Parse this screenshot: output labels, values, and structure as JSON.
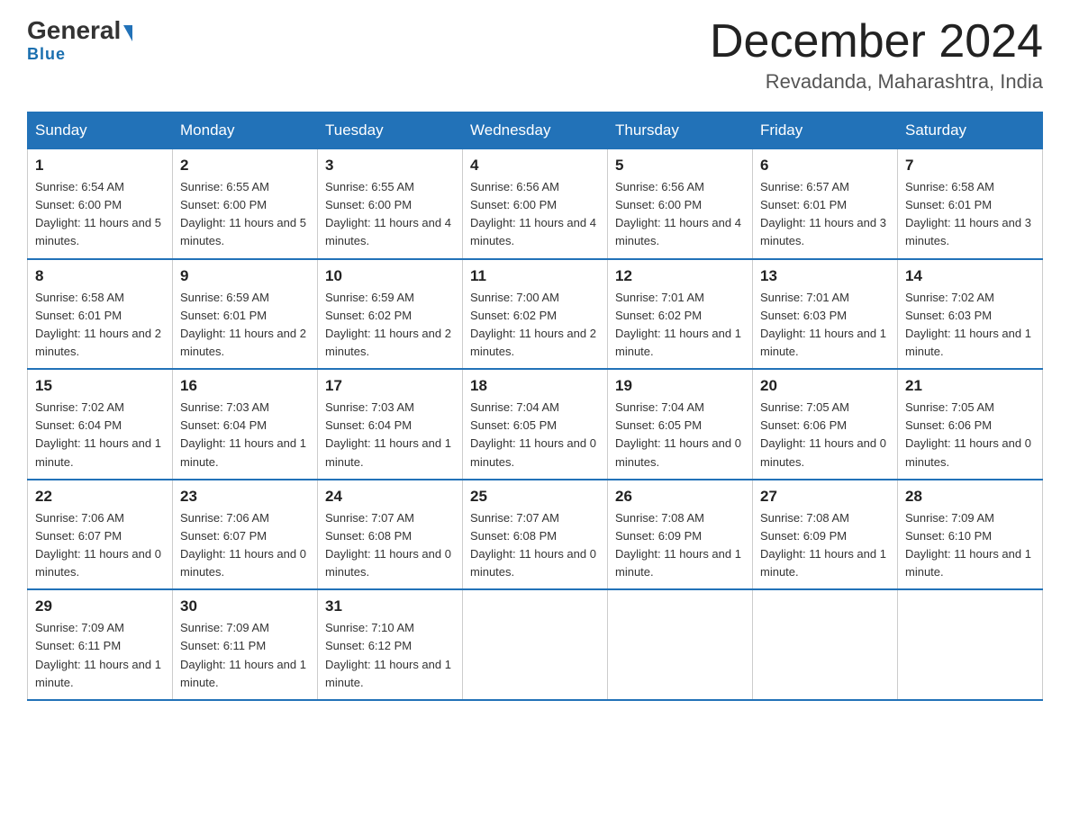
{
  "logo": {
    "general": "General",
    "blue": "Blue",
    "triangle": "▶"
  },
  "title": "December 2024",
  "location": "Revadanda, Maharashtra, India",
  "headers": [
    "Sunday",
    "Monday",
    "Tuesday",
    "Wednesday",
    "Thursday",
    "Friday",
    "Saturday"
  ],
  "weeks": [
    [
      {
        "day": "1",
        "sunrise": "6:54 AM",
        "sunset": "6:00 PM",
        "daylight": "11 hours and 5 minutes."
      },
      {
        "day": "2",
        "sunrise": "6:55 AM",
        "sunset": "6:00 PM",
        "daylight": "11 hours and 5 minutes."
      },
      {
        "day": "3",
        "sunrise": "6:55 AM",
        "sunset": "6:00 PM",
        "daylight": "11 hours and 4 minutes."
      },
      {
        "day": "4",
        "sunrise": "6:56 AM",
        "sunset": "6:00 PM",
        "daylight": "11 hours and 4 minutes."
      },
      {
        "day": "5",
        "sunrise": "6:56 AM",
        "sunset": "6:00 PM",
        "daylight": "11 hours and 4 minutes."
      },
      {
        "day": "6",
        "sunrise": "6:57 AM",
        "sunset": "6:01 PM",
        "daylight": "11 hours and 3 minutes."
      },
      {
        "day": "7",
        "sunrise": "6:58 AM",
        "sunset": "6:01 PM",
        "daylight": "11 hours and 3 minutes."
      }
    ],
    [
      {
        "day": "8",
        "sunrise": "6:58 AM",
        "sunset": "6:01 PM",
        "daylight": "11 hours and 2 minutes."
      },
      {
        "day": "9",
        "sunrise": "6:59 AM",
        "sunset": "6:01 PM",
        "daylight": "11 hours and 2 minutes."
      },
      {
        "day": "10",
        "sunrise": "6:59 AM",
        "sunset": "6:02 PM",
        "daylight": "11 hours and 2 minutes."
      },
      {
        "day": "11",
        "sunrise": "7:00 AM",
        "sunset": "6:02 PM",
        "daylight": "11 hours and 2 minutes."
      },
      {
        "day": "12",
        "sunrise": "7:01 AM",
        "sunset": "6:02 PM",
        "daylight": "11 hours and 1 minute."
      },
      {
        "day": "13",
        "sunrise": "7:01 AM",
        "sunset": "6:03 PM",
        "daylight": "11 hours and 1 minute."
      },
      {
        "day": "14",
        "sunrise": "7:02 AM",
        "sunset": "6:03 PM",
        "daylight": "11 hours and 1 minute."
      }
    ],
    [
      {
        "day": "15",
        "sunrise": "7:02 AM",
        "sunset": "6:04 PM",
        "daylight": "11 hours and 1 minute."
      },
      {
        "day": "16",
        "sunrise": "7:03 AM",
        "sunset": "6:04 PM",
        "daylight": "11 hours and 1 minute."
      },
      {
        "day": "17",
        "sunrise": "7:03 AM",
        "sunset": "6:04 PM",
        "daylight": "11 hours and 1 minute."
      },
      {
        "day": "18",
        "sunrise": "7:04 AM",
        "sunset": "6:05 PM",
        "daylight": "11 hours and 0 minutes."
      },
      {
        "day": "19",
        "sunrise": "7:04 AM",
        "sunset": "6:05 PM",
        "daylight": "11 hours and 0 minutes."
      },
      {
        "day": "20",
        "sunrise": "7:05 AM",
        "sunset": "6:06 PM",
        "daylight": "11 hours and 0 minutes."
      },
      {
        "day": "21",
        "sunrise": "7:05 AM",
        "sunset": "6:06 PM",
        "daylight": "11 hours and 0 minutes."
      }
    ],
    [
      {
        "day": "22",
        "sunrise": "7:06 AM",
        "sunset": "6:07 PM",
        "daylight": "11 hours and 0 minutes."
      },
      {
        "day": "23",
        "sunrise": "7:06 AM",
        "sunset": "6:07 PM",
        "daylight": "11 hours and 0 minutes."
      },
      {
        "day": "24",
        "sunrise": "7:07 AM",
        "sunset": "6:08 PM",
        "daylight": "11 hours and 0 minutes."
      },
      {
        "day": "25",
        "sunrise": "7:07 AM",
        "sunset": "6:08 PM",
        "daylight": "11 hours and 0 minutes."
      },
      {
        "day": "26",
        "sunrise": "7:08 AM",
        "sunset": "6:09 PM",
        "daylight": "11 hours and 1 minute."
      },
      {
        "day": "27",
        "sunrise": "7:08 AM",
        "sunset": "6:09 PM",
        "daylight": "11 hours and 1 minute."
      },
      {
        "day": "28",
        "sunrise": "7:09 AM",
        "sunset": "6:10 PM",
        "daylight": "11 hours and 1 minute."
      }
    ],
    [
      {
        "day": "29",
        "sunrise": "7:09 AM",
        "sunset": "6:11 PM",
        "daylight": "11 hours and 1 minute."
      },
      {
        "day": "30",
        "sunrise": "7:09 AM",
        "sunset": "6:11 PM",
        "daylight": "11 hours and 1 minute."
      },
      {
        "day": "31",
        "sunrise": "7:10 AM",
        "sunset": "6:12 PM",
        "daylight": "11 hours and 1 minute."
      },
      null,
      null,
      null,
      null
    ]
  ],
  "labels": {
    "sunrise": "Sunrise:",
    "sunset": "Sunset:",
    "daylight": "Daylight:"
  }
}
